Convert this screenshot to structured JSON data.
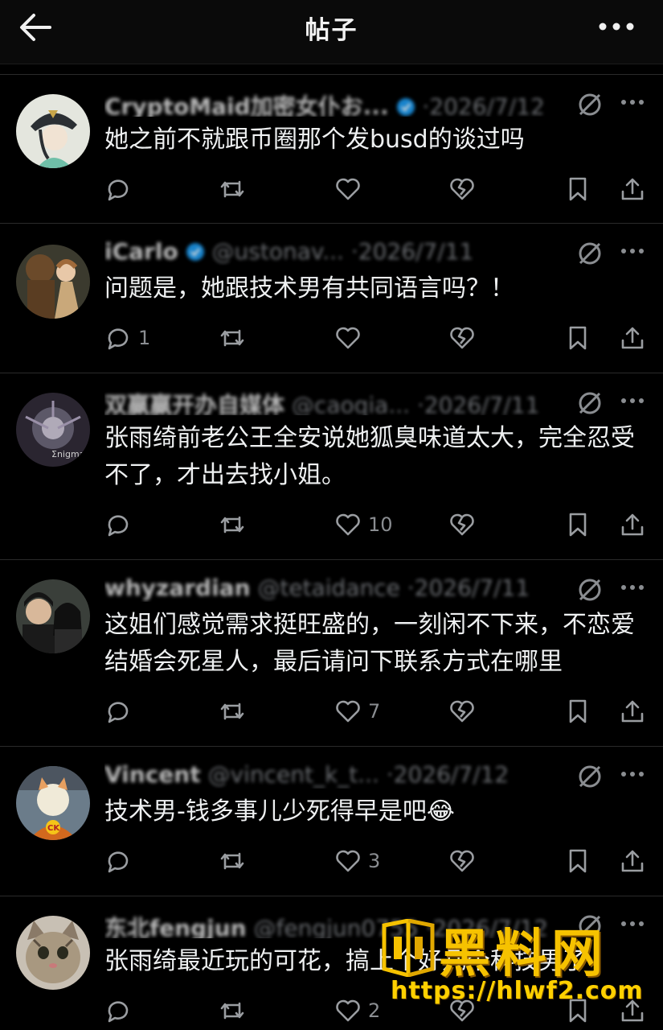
{
  "header": {
    "title": "帖子",
    "back_icon": "arrow-left-icon",
    "more_icon": "ellipsis-icon"
  },
  "posts": [
    {
      "name": "CryptoMaid加密女仆お...",
      "handle": "",
      "date": "·2026/7/12",
      "verified": true,
      "text": "她之前不就跟币圈那个发busd的谈过吗",
      "replies": "",
      "likes": ""
    },
    {
      "name": "iCarlo",
      "handle": "@ustonav...",
      "date": "·2026/7/11",
      "verified": true,
      "text": "问题是，她跟技术男有共同语言吗？！",
      "replies": "1",
      "likes": ""
    },
    {
      "name": "双赢赢开办自媒体",
      "handle": "@caoqia...",
      "date": "·2026/7/11",
      "verified": false,
      "text": "张雨绮前老公王全安说她狐臭味道太大，完全忍受不了，才出去找小姐。",
      "replies": "",
      "likes": "10"
    },
    {
      "name": "whyzardian",
      "handle": "@tetaidance",
      "date": "·2026/7/11",
      "verified": false,
      "text": "这姐们感觉需求挺旺盛的，一刻闲不下来，不恋爱结婚会死星人，最后请问下联系方式在哪里",
      "replies": "",
      "likes": "7"
    },
    {
      "name": "Vincent",
      "handle": "@vincent_k_t...",
      "date": "·2026/7/12",
      "verified": false,
      "text": "技术男-钱多事儿少死得早是吧😂",
      "replies": "",
      "likes": "3"
    },
    {
      "name": "东北fengjun",
      "handle": "@fengjun0755",
      "date": "·2026/7/12",
      "verified": false,
      "text": "张雨绮最近玩的可花，搞上个好几个科技男了",
      "replies": "",
      "likes": "2"
    }
  ],
  "watermark": {
    "title": "黑料网",
    "url": "https://hlwf2.com"
  },
  "colors": {
    "background": "#000000",
    "text": "#eef0f1",
    "muted": "#8a8d91",
    "verified": "#1d9bf0",
    "watermark": "#f6c200"
  }
}
